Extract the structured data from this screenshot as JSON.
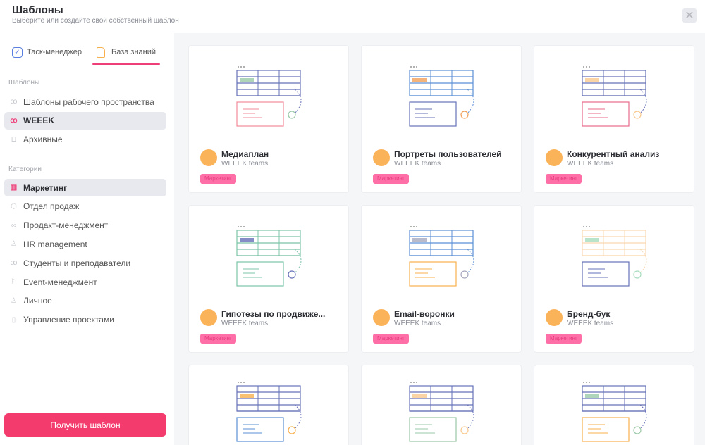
{
  "header": {
    "title": "Шаблоны",
    "subtitle": "Выберите или создайте свой собственный шаблон"
  },
  "tabs": [
    {
      "label": "Таск-менеджер"
    },
    {
      "label": "База знаний"
    }
  ],
  "sidebar": {
    "templates_heading": "Шаблоны",
    "templates": [
      {
        "label": "Шаблоны рабочего пространства",
        "icon": "team-icon"
      },
      {
        "label": "WEEEK",
        "icon": "team-icon",
        "active": true
      },
      {
        "label": "Архивные",
        "icon": "archive-icon"
      }
    ],
    "categories_heading": "Категории",
    "categories": [
      {
        "label": "Маркетинг",
        "icon": "chart-icon",
        "active": true
      },
      {
        "label": "Отдел продаж",
        "icon": "box-icon"
      },
      {
        "label": "Продакт-менеджмент",
        "icon": "nodes-icon"
      },
      {
        "label": "HR management",
        "icon": "user-plus-icon"
      },
      {
        "label": "Студенты и преподаватели",
        "icon": "team-icon"
      },
      {
        "label": "Event-менеджмент",
        "icon": "flag-icon"
      },
      {
        "label": "Личное",
        "icon": "user-icon"
      },
      {
        "label": "Управление проектами",
        "icon": "columns-icon"
      }
    ],
    "get_button": "Получить шаблон"
  },
  "cards": [
    {
      "name": "Медиаплан",
      "team": "WEEEK teams",
      "badge": "Маркетинг"
    },
    {
      "name": "Портреты пользователей",
      "team": "WEEEK teams",
      "badge": "Маркетинг"
    },
    {
      "name": "Конкурентный анализ",
      "team": "WEEEK teams",
      "badge": "Маркетинг"
    },
    {
      "name": "Гипотезы по продвиже...",
      "team": "WEEEK teams",
      "badge": "Маркетинг"
    },
    {
      "name": "Email-воронки",
      "team": "WEEEK teams",
      "badge": "Маркетинг"
    },
    {
      "name": "Бренд-бук",
      "team": "WEEEK teams",
      "badge": "Маркетинг"
    },
    {
      "name": "",
      "team": "",
      "badge": ""
    },
    {
      "name": "",
      "team": "",
      "badge": ""
    },
    {
      "name": "",
      "team": "",
      "badge": ""
    }
  ],
  "colors": {
    "accent": "#f43b6e",
    "avatar": "#fbb35a",
    "badge_bg": "#ff6fa7"
  }
}
